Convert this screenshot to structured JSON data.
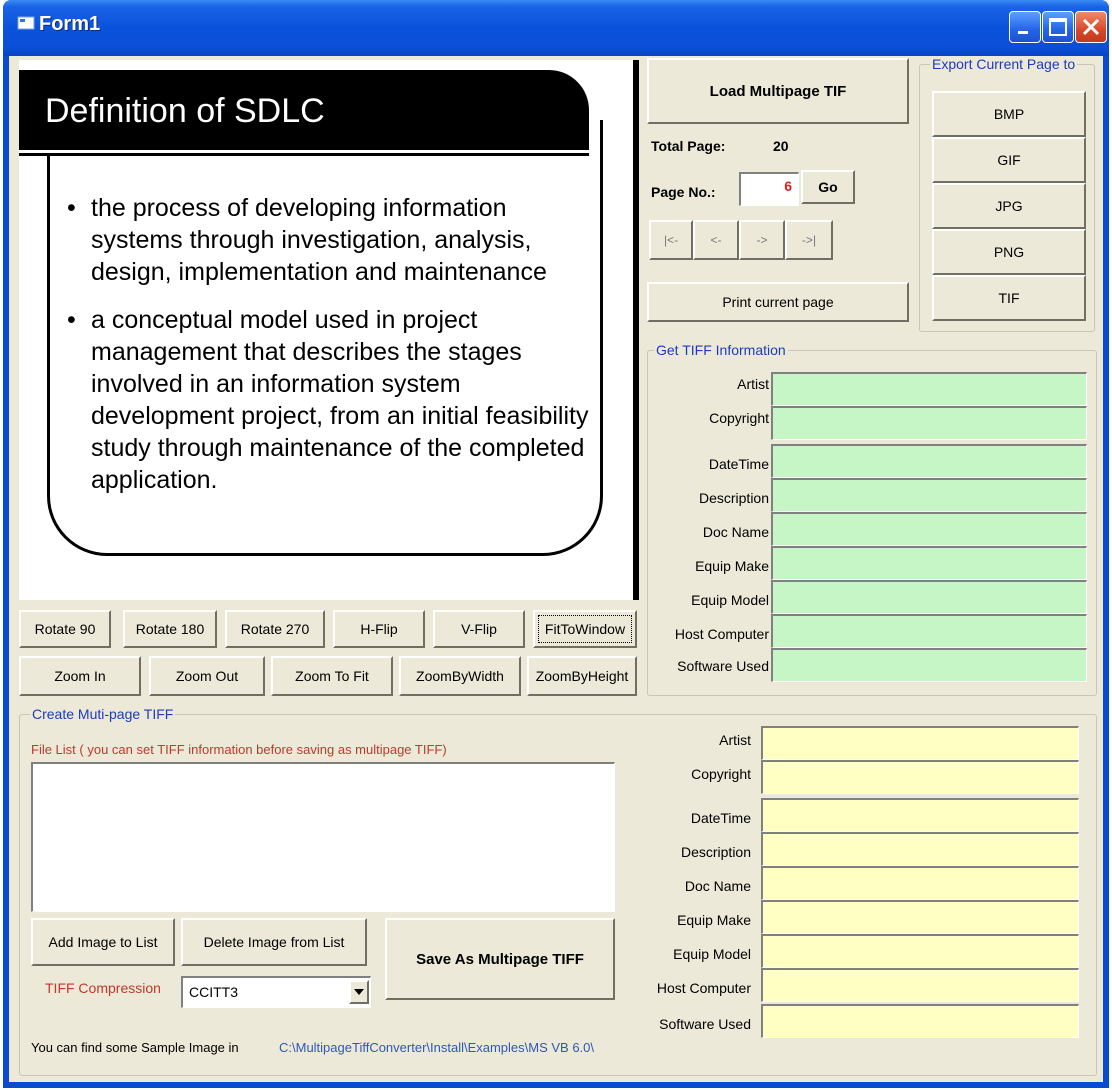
{
  "window": {
    "title": "Form1"
  },
  "slide": {
    "heading": "Definition of SDLC",
    "bullets": [
      "the process of developing information systems through investigation, analysis, design, implementation and maintenance",
      "a conceptual model used in project management that describes the stages involved in an information system development project, from an initial feasibility study through maintenance of the completed application."
    ]
  },
  "image_toolbar": {
    "row1": [
      "Rotate 90",
      "Rotate 180",
      "Rotate 270",
      "H-Flip",
      "V-Flip",
      "FitToWindow"
    ],
    "row2": [
      "Zoom In",
      "Zoom Out",
      "Zoom To Fit",
      "ZoomByWidth",
      "ZoomByHeight"
    ]
  },
  "navigation": {
    "load_label": "Load Multipage TIF",
    "total_page_label": "Total Page:",
    "total_page_value": "20",
    "page_no_label": "Page No.:",
    "page_no_value": "6",
    "go_label": "Go",
    "first_label": "|<-",
    "prev_label": "<-",
    "next_label": "->",
    "last_label": "->|",
    "print_label": "Print current page"
  },
  "export": {
    "title": "Export Current Page to",
    "formats": [
      "BMP",
      "GIF",
      "JPG",
      "PNG",
      "TIF"
    ]
  },
  "tiff_info": {
    "title": "Get TIFF Information",
    "fields": [
      "Artist",
      "Copyright",
      "DateTime",
      "Description",
      "Doc Name",
      "Equip Make",
      "Equip Model",
      "Host Computer",
      "Software Used"
    ]
  },
  "create": {
    "title": "Create Muti-page TIFF",
    "file_list_label": "File List ( you can set TIFF information before saving as multipage TIFF)",
    "add_label": "Add Image to List",
    "delete_label": "Delete Image from List",
    "save_label": "Save As Multipage TIFF",
    "compression_label": "TIFF Compression",
    "compression_value": "CCITT3",
    "sample_label": "You can find some Sample Image in",
    "sample_path": "C:\\MultipageTiffConverter\\Install\\Examples\\MS VB 6.0\\",
    "fields": [
      "Artist",
      "Copyright",
      "DateTime",
      "Description",
      "Doc Name",
      "Equip Make",
      "Equip Model",
      "Host Computer",
      "Software Used"
    ]
  },
  "colors": {
    "titlebar": "#0a52dc",
    "form_bg": "#ece9d8",
    "info_field": "#c6f5c6",
    "create_field": "#ffffc4",
    "group_title": "#1c3bbd",
    "red_label": "#c0392b"
  }
}
